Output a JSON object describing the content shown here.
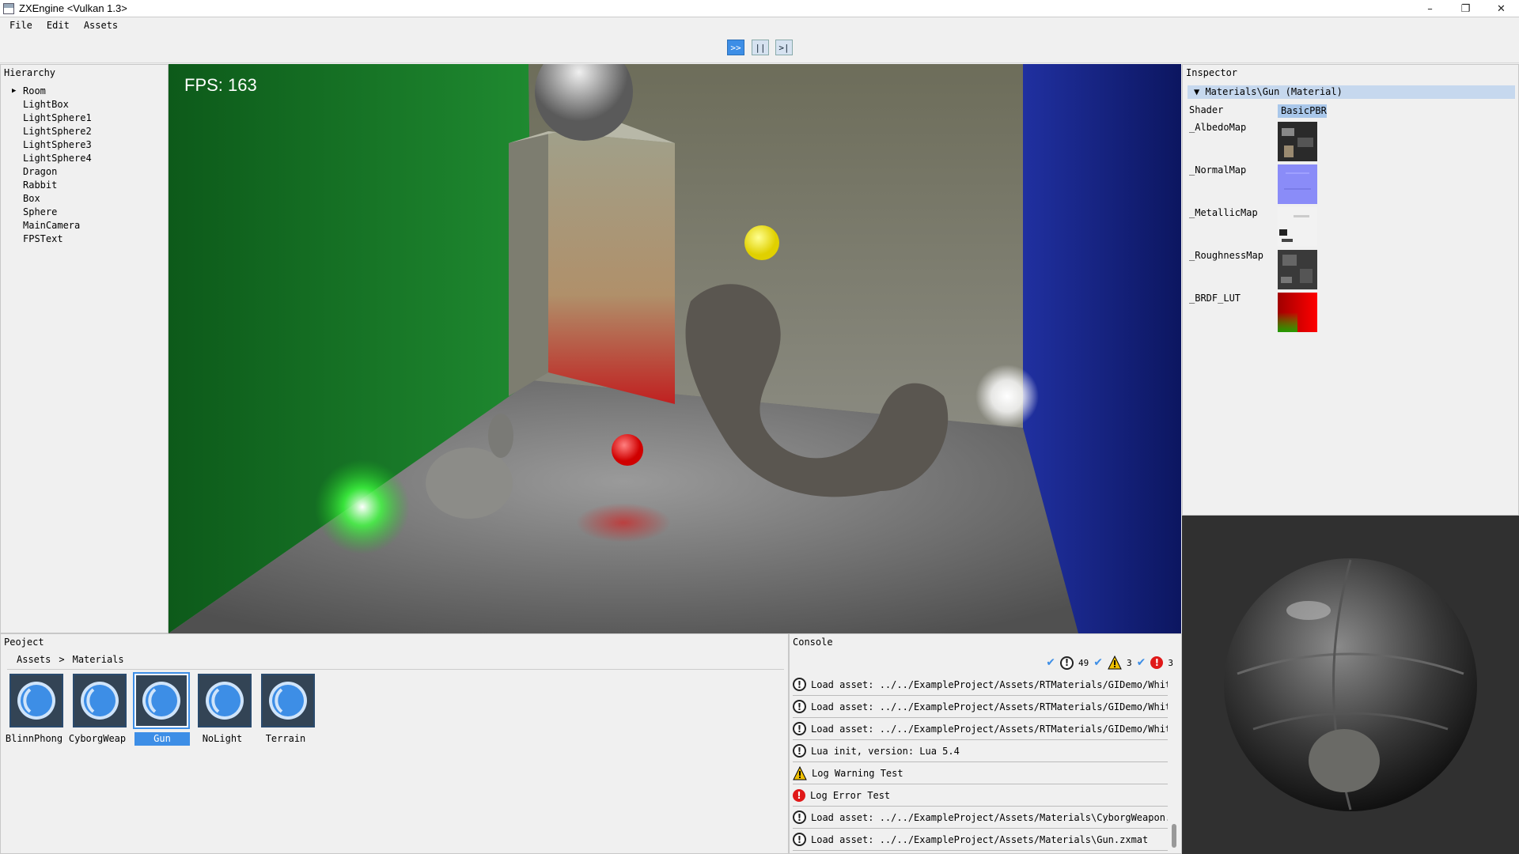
{
  "window": {
    "title": "ZXEngine <Vulkan 1.3>",
    "controls": [
      "–",
      "❐",
      "✕"
    ]
  },
  "menu": [
    "File",
    "Edit",
    "Assets"
  ],
  "toolbar": {
    "play_label": ">>",
    "pause_label": "||",
    "step_label": ">|"
  },
  "hierarchy": {
    "title": "Hierarchy",
    "items": [
      "Room",
      "LightBox",
      "LightSphere1",
      "LightSphere2",
      "LightSphere3",
      "LightSphere4",
      "Dragon",
      "Rabbit",
      "Box",
      "Sphere",
      "MainCamera",
      "FPSText"
    ]
  },
  "viewport": {
    "fps_text": "FPS: 163"
  },
  "inspector": {
    "title": "Inspector",
    "header": "▼ Materials\\Gun (Material)",
    "shader_label": "Shader",
    "shader_value": "BasicPBR",
    "properties": [
      "_AlbedoMap",
      "_NormalMap",
      "_MetallicMap",
      "_RoughnessMap",
      "_BRDF_LUT"
    ]
  },
  "project": {
    "title": "Peoject",
    "breadcrumb": [
      "Assets",
      ">",
      "Materials"
    ],
    "assets": [
      "BlinnPhong",
      "CyborgWeap",
      "Gun",
      "NoLight",
      "Terrain"
    ],
    "selected": "Gun"
  },
  "console": {
    "title": "Console",
    "counts": {
      "info": "49",
      "warning": "3",
      "error": "3"
    },
    "logs": [
      {
        "type": "info",
        "text": "Load asset: ../../ExampleProject/Assets/RTMaterials/GIDemo/White"
      },
      {
        "type": "info",
        "text": "Load asset: ../../ExampleProject/Assets/RTMaterials/GIDemo/White"
      },
      {
        "type": "info",
        "text": "Load asset: ../../ExampleProject/Assets/RTMaterials/GIDemo/White"
      },
      {
        "type": "info",
        "text": "Lua init, version: Lua 5.4"
      },
      {
        "type": "warning",
        "text": "Log Warning Test"
      },
      {
        "type": "error",
        "text": "Log Error Test"
      },
      {
        "type": "info",
        "text": "Load asset: ../../ExampleProject/Assets/Materials\\CyborgWeapon.z"
      },
      {
        "type": "info",
        "text": "Load asset: ../../ExampleProject/Assets/Materials\\Gun.zxmat"
      }
    ]
  },
  "colors": {
    "accent": "#3d8ee6",
    "panel_bg": "#f0f0f0",
    "wall_green": "#1e8a2e",
    "wall_blue": "#1a2a8a",
    "error_red": "#e01818"
  }
}
